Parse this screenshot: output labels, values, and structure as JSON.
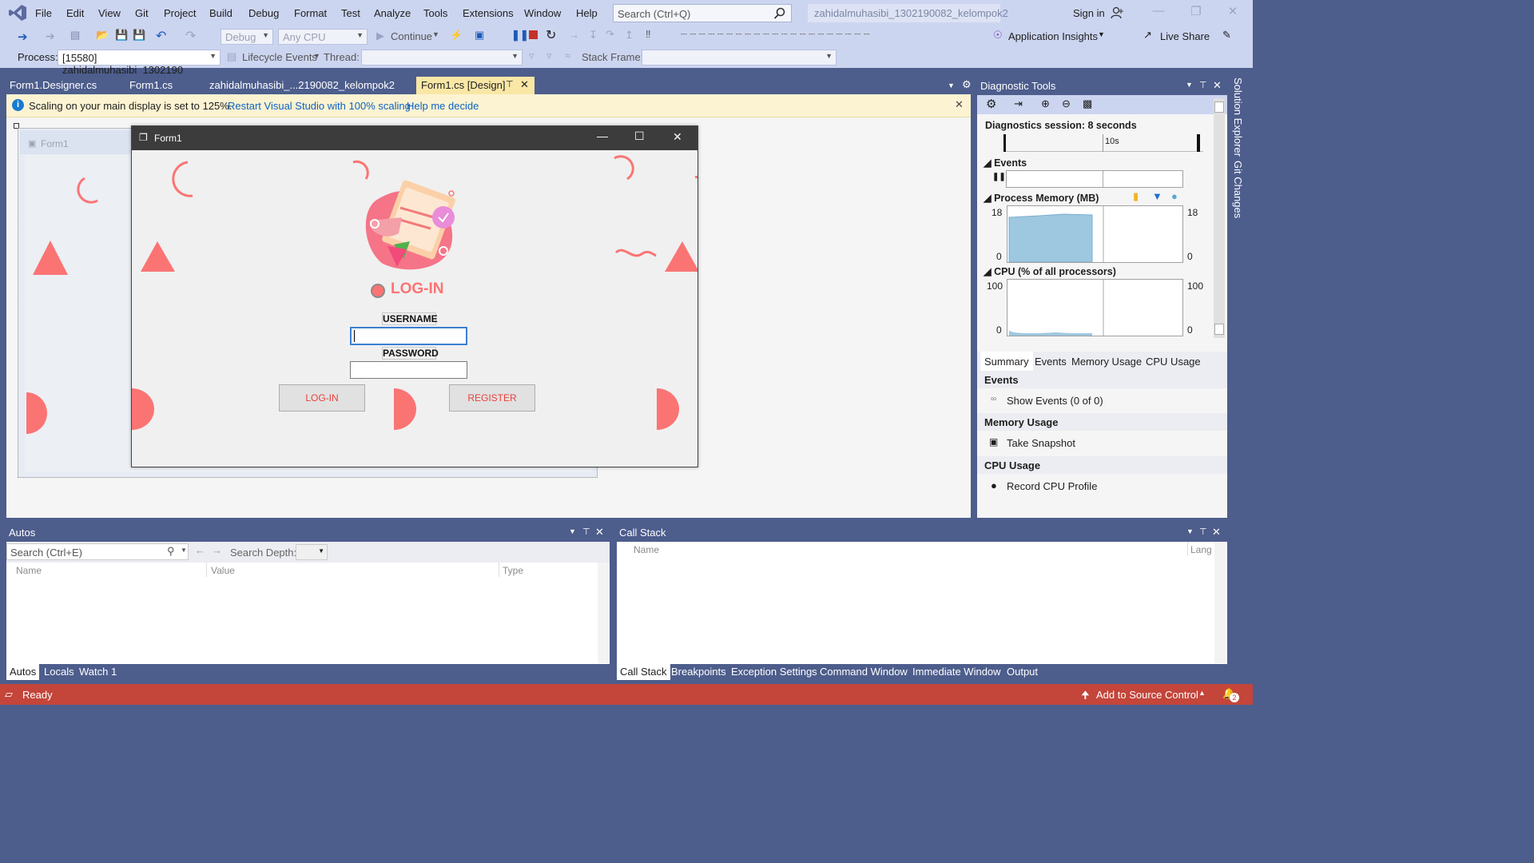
{
  "menu": [
    "File",
    "Edit",
    "View",
    "Git",
    "Project",
    "Build",
    "Debug",
    "Format",
    "Test",
    "Analyze",
    "Tools",
    "Extensions",
    "Window",
    "Help"
  ],
  "search": {
    "placeholder": "Search (Ctrl+Q)"
  },
  "solution_name": "zahidalmuhasibi_1302190082_kelompok2",
  "sign_in": "Sign in",
  "toolbar": {
    "config": "Debug",
    "platform": "Any CPU",
    "continue": "Continue",
    "app_insights": "Application Insights",
    "live_share": "Live Share",
    "process_label": "Process:",
    "process_value": "[15580] zahidalmuhasibi_1302190",
    "lifecycle": "Lifecycle Events",
    "thread_label": "Thread:",
    "stack_frame_label": "Stack Frame:"
  },
  "doc_tabs": [
    "Form1.Designer.cs",
    "Form1.cs",
    "zahidalmuhasibi_...2190082_kelompok2",
    "Form1.cs [Design]"
  ],
  "infobar": {
    "message": "Scaling on your main display is set to 125%.",
    "link1": "Restart Visual Studio with 100% scaling",
    "link2": "Help me decide"
  },
  "designer": {
    "bg_form_title": "Form1",
    "form_title": "Form1",
    "heading": "LOG-IN",
    "username_label": "USERNAME",
    "password_label": "PASSWORD",
    "login_button": "LOG-IN",
    "register_button": "REGISTER"
  },
  "diagnostics": {
    "title": "Diagnostic Tools",
    "session": "Diagnostics session: 8 seconds",
    "timeline_tick": "10s",
    "events_label": "Events",
    "memory_label": "Process Memory (MB)",
    "memory_max": "18",
    "memory_min": "0",
    "cpu_label": "CPU (% of all processors)",
    "cpu_max": "100",
    "cpu_min": "0",
    "tabs": [
      "Summary",
      "Events",
      "Memory Usage",
      "CPU Usage"
    ],
    "sections": {
      "events_head": "Events",
      "show_events": "Show Events (0 of 0)",
      "memory_head": "Memory Usage",
      "take_snapshot": "Take Snapshot",
      "cpu_head": "CPU Usage",
      "record_cpu": "Record CPU Profile"
    },
    "colors": {
      "memory_fill": "#9ec8df",
      "marker_yellow": "#f0b429",
      "marker_blue": "#1f6fd1",
      "marker_teal": "#5aa8d4"
    }
  },
  "side_tabs": [
    "Solution Explorer",
    "Git Changes"
  ],
  "autos": {
    "title": "Autos",
    "search_placeholder": "Search (Ctrl+E)",
    "search_depth": "Search Depth:",
    "columns": [
      "Name",
      "Value",
      "Type"
    ],
    "tabs": [
      "Autos",
      "Locals",
      "Watch 1"
    ]
  },
  "callstack": {
    "title": "Call Stack",
    "columns": [
      "Name",
      "Lang"
    ],
    "tabs": [
      "Call Stack",
      "Breakpoints",
      "Exception Settings",
      "Command Window",
      "Immediate Window",
      "Output"
    ]
  },
  "status": {
    "ready": "Ready",
    "source_control": "Add to Source Control",
    "notifications": "2"
  },
  "accent": {
    "salmon": "#fb7474",
    "vs_blue": "#4d5d8c",
    "status_red": "#c4453a"
  }
}
